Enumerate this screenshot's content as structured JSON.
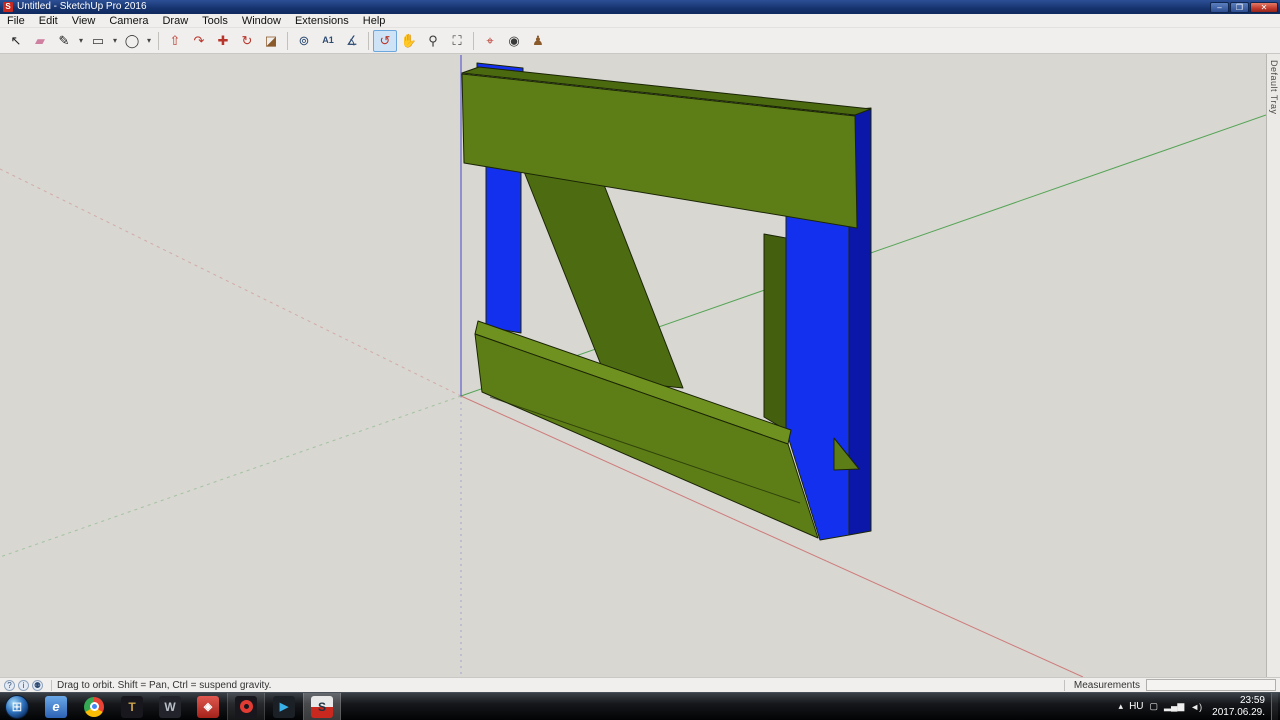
{
  "window": {
    "icon_letter": "S",
    "title": "Untitled - SketchUp Pro 2016",
    "minimize_glyph": "–",
    "maximize_glyph": "❐",
    "close_glyph": "✕"
  },
  "menu_bar": {
    "items": [
      "File",
      "Edit",
      "View",
      "Camera",
      "Draw",
      "Tools",
      "Window",
      "Extensions",
      "Help"
    ]
  },
  "toolbar": {
    "dropdown_glyph": "▾",
    "active_tool": "Orbit",
    "tools": [
      {
        "name": "Select",
        "glyph": "↖"
      },
      {
        "name": "Eraser",
        "glyph": "▰"
      },
      {
        "name": "Line",
        "glyph": "✎"
      },
      {
        "name": "Shapes",
        "glyph": "▭"
      },
      {
        "name": "Circle",
        "glyph": "◯"
      },
      {
        "name": "Push/Pull",
        "glyph": "⇧"
      },
      {
        "name": "Follow Me",
        "glyph": "↷"
      },
      {
        "name": "Move",
        "glyph": "✚"
      },
      {
        "name": "Rotate",
        "glyph": "↻"
      },
      {
        "name": "Paint Bucket",
        "glyph": "◪"
      },
      {
        "name": "Tape Measure",
        "glyph": "⊚"
      },
      {
        "name": "Text",
        "glyph": "A1"
      },
      {
        "name": "Protractor",
        "glyph": "∡"
      },
      {
        "name": "Orbit",
        "glyph": "↺"
      },
      {
        "name": "Pan",
        "glyph": "✋"
      },
      {
        "name": "Zoom",
        "glyph": "⚲"
      },
      {
        "name": "Zoom Extents",
        "glyph": "⛶"
      },
      {
        "name": "Position Camera",
        "glyph": "⌖"
      },
      {
        "name": "Look Around",
        "glyph": "◉"
      },
      {
        "name": "Walk",
        "glyph": "♟"
      }
    ]
  },
  "viewport": {
    "background": "#d8d7d2",
    "axes": {
      "red": "#cc6666",
      "green": "#55a455",
      "blue": "#4646cc"
    },
    "model": {
      "colors": {
        "green_front": "#5d7e16",
        "green_top": "#4b690f",
        "green_light": "#6f911f",
        "green_dark": "#4d6c12",
        "green_dark2": "#44600f",
        "blue_front": "#1430ef",
        "blue_side": "#0a17a8",
        "edge": "#1b2506"
      }
    }
  },
  "default_tray": {
    "label": "Default Tray"
  },
  "status_bar": {
    "help_glyph": "?",
    "info_glyph": "i",
    "person_glyph": "⚉",
    "hint": "Drag to orbit. Shift = Pan, Ctrl = suspend gravity.",
    "measurements_label": "Measurements",
    "measurements_value": ""
  },
  "taskbar": {
    "start_glyph": "⊞",
    "apps": [
      {
        "name": "internet-explorer",
        "glyph": "e"
      },
      {
        "name": "chrome",
        "glyph": ""
      },
      {
        "name": "world-of-tanks",
        "glyph": "T"
      },
      {
        "name": "wargaming-center",
        "glyph": "W"
      },
      {
        "name": "red-media-app",
        "glyph": "◈"
      },
      {
        "name": "opera",
        "glyph": ""
      },
      {
        "name": "media-player",
        "glyph": "▶"
      },
      {
        "name": "sketchup",
        "glyph": "S"
      }
    ],
    "tray": {
      "hidden_icons_glyph": "▴",
      "language": "HU",
      "icon1": "▢",
      "icon2": "▂▄▆",
      "icon3": "◄)",
      "time": "23:59",
      "date": "2017.06.29."
    }
  }
}
